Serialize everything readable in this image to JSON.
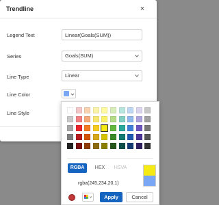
{
  "dialog": {
    "title": "Trendline",
    "close_icon": "close-icon",
    "close_glyph": "×"
  },
  "form": {
    "legend_text": {
      "label": "Legend Text",
      "value": "Linear(Goals(SUM))"
    },
    "series": {
      "label": "Series",
      "value": "Goals(SUM)"
    },
    "line_type": {
      "label": "Line Type",
      "value": "Linear"
    },
    "line_color": {
      "label": "Line Color",
      "current_color": "#7aa7f5"
    },
    "line_style": {
      "label": "Line Style"
    }
  },
  "color_picker": {
    "palette": [
      [
        "#ffffff",
        "#f5c6c6",
        "#f9d2b0",
        "#fbf3a8",
        "#fff9a0",
        "#d7edb9",
        "#b9e5df",
        "#bfd6f2",
        "#d9d3ee",
        "#c8c8c8"
      ],
      [
        "#c9c9c9",
        "#f08080",
        "#f5aa78",
        "#f7e66e",
        "#faf06a",
        "#b4db87",
        "#84cfc3",
        "#8eb6ea",
        "#ada3dc",
        "#a0a0a0"
      ],
      [
        "#a8a8a8",
        "#e8262b",
        "#f27a22",
        "#f5cb1e",
        "#f5ea14",
        "#61b63d",
        "#2aa69a",
        "#3f7fd8",
        "#6d55c0",
        "#777777"
      ],
      [
        "#7f7f7f",
        "#b71c1c",
        "#d35400",
        "#d6a81a",
        "#d4c200",
        "#3a8a28",
        "#137b72",
        "#1f58b0",
        "#4a3596",
        "#555555"
      ],
      [
        "#222222",
        "#7a1010",
        "#8e3a06",
        "#8c6a0d",
        "#8a7e00",
        "#24561a",
        "#0c4f49",
        "#143a74",
        "#2f2161",
        "#333333"
      ]
    ],
    "selected": {
      "row": 2,
      "col": 4
    },
    "modes": [
      "RGBA",
      "HEX",
      "HSVA"
    ],
    "active_mode": "RGBA",
    "value": "rgba(245,234,20,1)",
    "preview_new": "#f5ea14",
    "preview_old": "#7aa7f5",
    "apply_label": "Apply",
    "cancel_label": "Cancel"
  },
  "colors": {
    "accent": "#1565c0",
    "overlay": "#8a8a8a"
  }
}
